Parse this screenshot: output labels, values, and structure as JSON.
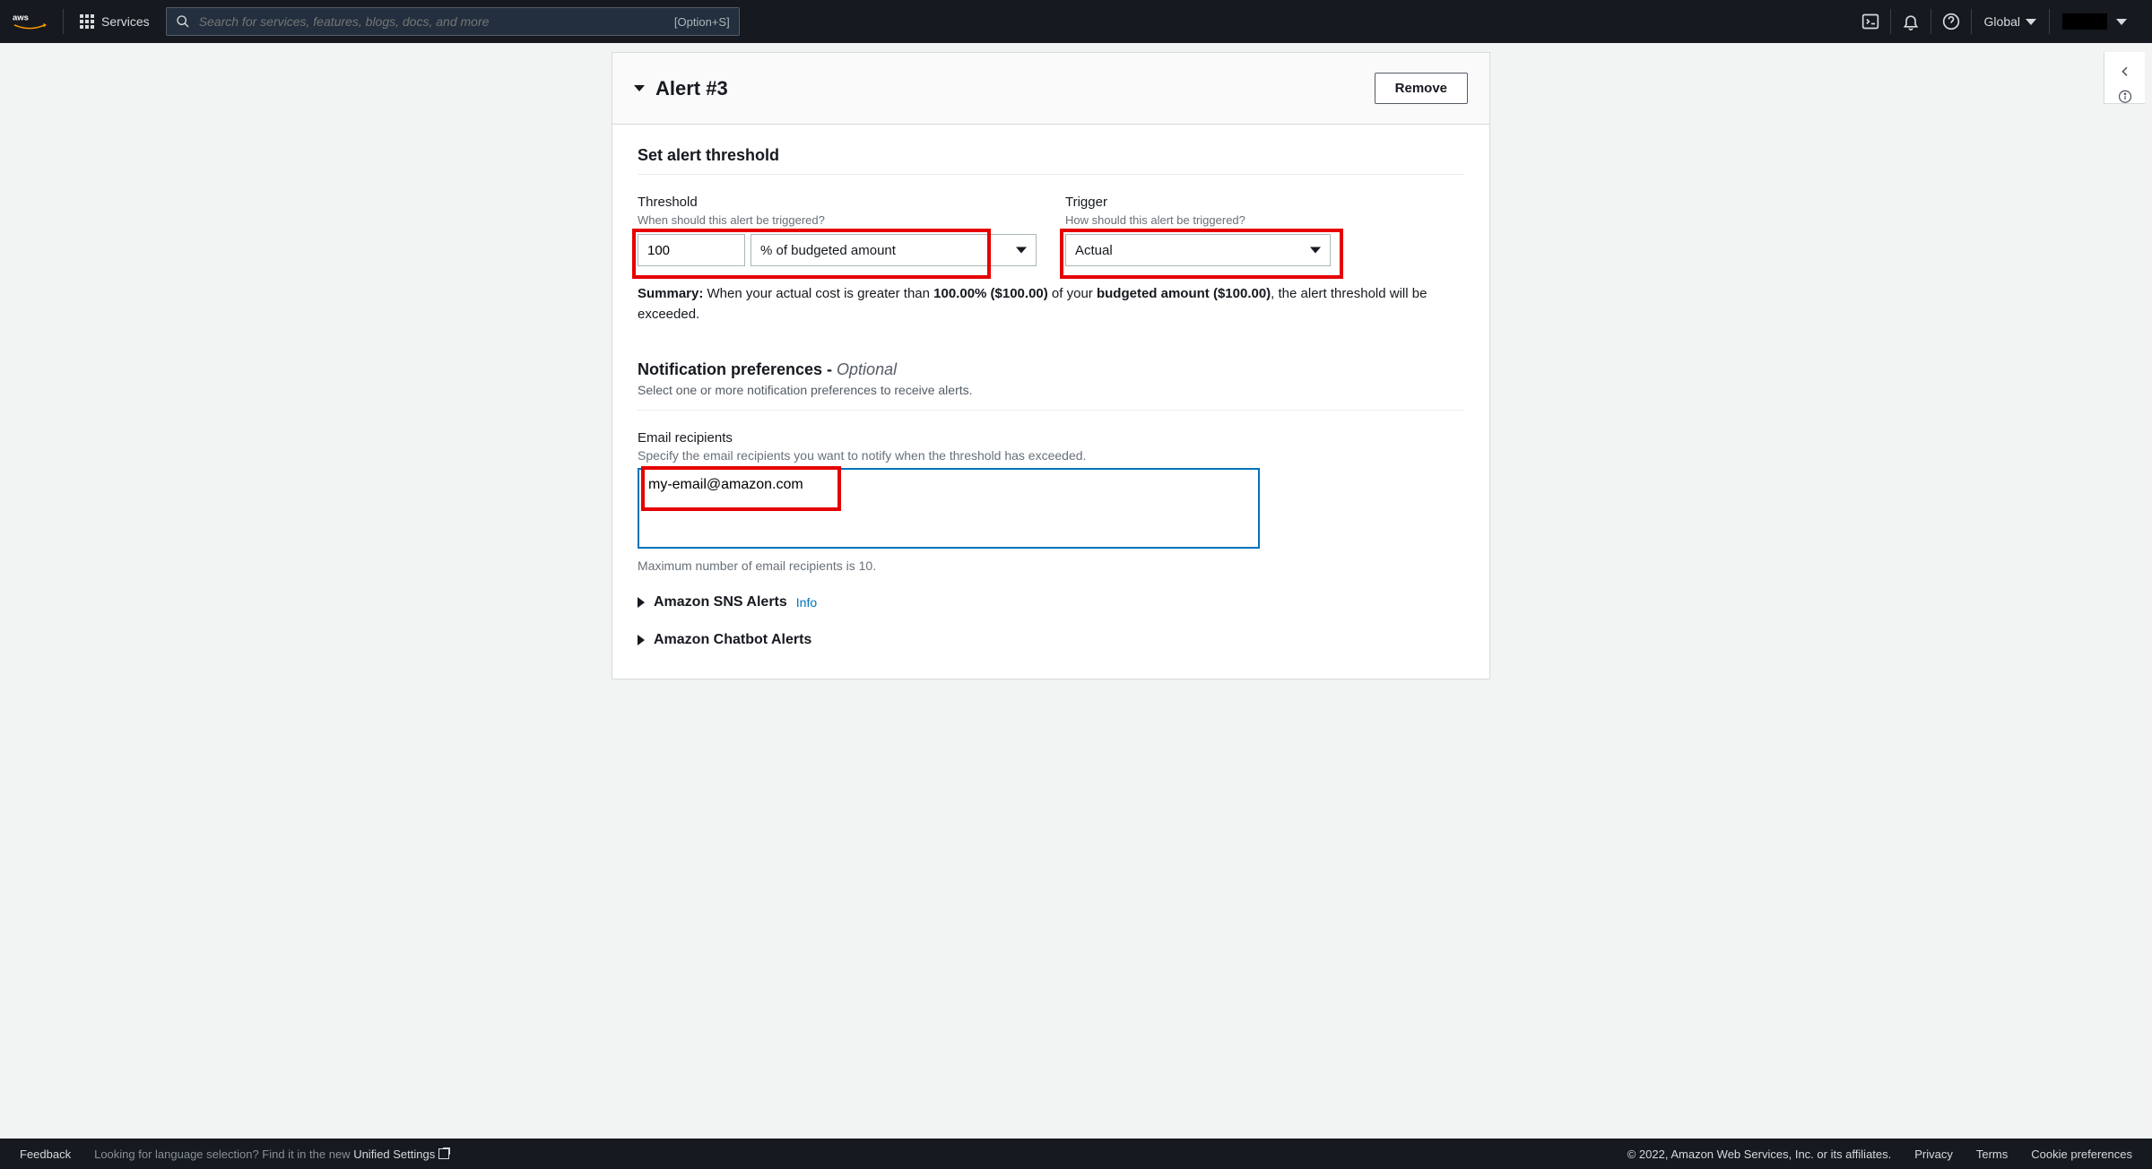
{
  "nav": {
    "services_label": "Services",
    "search_placeholder": "Search for services, features, blogs, docs, and more",
    "search_shortcut": "[Option+S]",
    "region": "Global"
  },
  "card": {
    "title": "Alert #3",
    "remove": "Remove"
  },
  "threshold_section": {
    "title": "Set alert threshold",
    "threshold_label": "Threshold",
    "threshold_hint": "When should this alert be triggered?",
    "threshold_value": "100",
    "threshold_unit": "% of budgeted amount",
    "trigger_label": "Trigger",
    "trigger_hint": "How should this alert be triggered?",
    "trigger_value": "Actual"
  },
  "summary": {
    "prefix": "Summary:",
    "part1": " When your actual cost is greater than ",
    "pct_amount": "100.00% ($100.00)",
    "part2": " of your ",
    "budget_amount": "budgeted amount ($100.00)",
    "part3": ", the alert threshold will be exceeded."
  },
  "notifications": {
    "title": "Notification preferences - ",
    "optional": "Optional",
    "subtitle": "Select one or more notification preferences to receive alerts.",
    "email_label": "Email recipients",
    "email_hint": "Specify the email recipients you want to notify when the threshold has exceeded.",
    "email_value": "my-email@amazon.com",
    "email_max": "Maximum number of email recipients is 10.",
    "sns": "Amazon SNS Alerts",
    "sns_info": "Info",
    "chatbot": "Amazon Chatbot Alerts"
  },
  "footer": {
    "feedback": "Feedback",
    "lang_prompt": "Looking for language selection? Find it in the new ",
    "unified": "Unified Settings",
    "copyright": "© 2022, Amazon Web Services, Inc. or its affiliates.",
    "privacy": "Privacy",
    "terms": "Terms",
    "cookie": "Cookie preferences"
  }
}
